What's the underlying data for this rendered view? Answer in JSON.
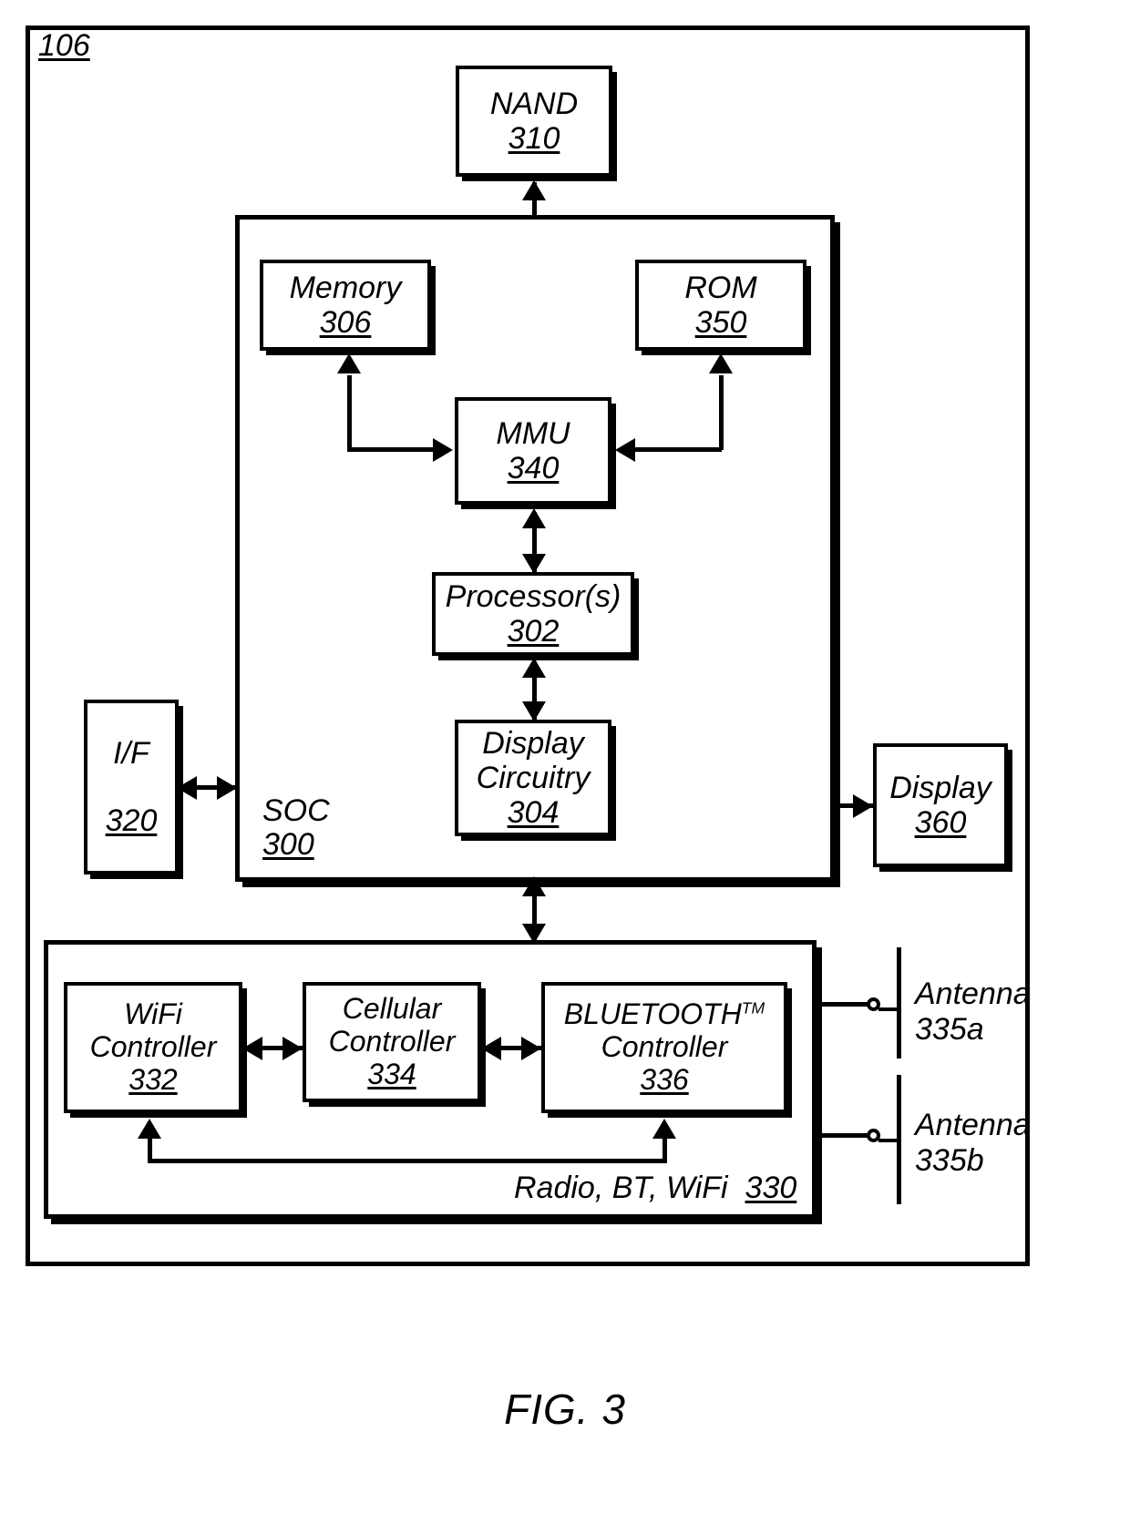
{
  "figure": {
    "caption": "FIG. 3",
    "outer_ref": "106"
  },
  "blocks": {
    "nand": {
      "label": "NAND",
      "ref": "310"
    },
    "memory": {
      "label": "Memory",
      "ref": "306"
    },
    "rom": {
      "label": "ROM",
      "ref": "350"
    },
    "mmu": {
      "label": "MMU",
      "ref": "340"
    },
    "processor": {
      "label": "Processor(s)",
      "ref": "302"
    },
    "display_circuitry": {
      "label_line1": "Display",
      "label_line2": "Circuitry",
      "ref": "304"
    },
    "interface": {
      "label": "I/F",
      "ref": "320"
    },
    "display": {
      "label": "Display",
      "ref": "360"
    },
    "soc": {
      "label": "SOC",
      "ref": "300"
    },
    "radio": {
      "label": "Radio, BT, WiFi",
      "ref": "330"
    },
    "wifi_controller": {
      "label_line1": "WiFi",
      "label_line2": "Controller",
      "ref": "332"
    },
    "cellular_controller": {
      "label_line1": "Cellular",
      "label_line2": "Controller",
      "ref": "334"
    },
    "bluetooth_controller": {
      "label_line1": "BLUETOOTH",
      "trademark": "TM",
      "label_line2": "Controller",
      "ref": "336"
    }
  },
  "antennas": [
    {
      "label": "Antenna",
      "ref": "335a"
    },
    {
      "label": "Antenna",
      "ref": "335b"
    }
  ],
  "colors": {
    "ink": "#000000",
    "paper": "#ffffff"
  }
}
